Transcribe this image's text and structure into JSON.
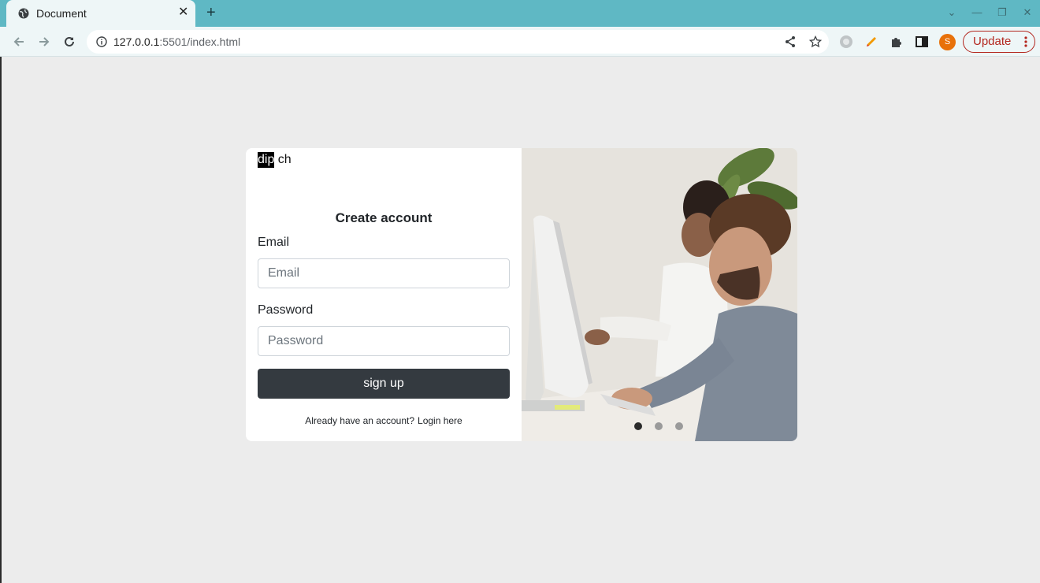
{
  "browser": {
    "tab_title": "Document",
    "url_host": "127.0.0.1",
    "url_rest": ":5501/index.html",
    "profile_initial": "S",
    "update_label": "Update"
  },
  "logo": {
    "highlight": "dip",
    "rest": " ch"
  },
  "form": {
    "title": "Create account",
    "email_label": "Email",
    "email_placeholder": "Email",
    "password_label": "Password",
    "password_placeholder": "Password",
    "submit_label": "sign up",
    "footer_text": "Already have an account?",
    "footer_link": "Login here"
  },
  "carousel": {
    "slide_count": 3,
    "active_index": 0
  },
  "colors": {
    "tab_strip": "#5fb8c4",
    "button_dark": "#343a40",
    "update_red": "#b3261e",
    "avatar_orange": "#e8710a"
  }
}
